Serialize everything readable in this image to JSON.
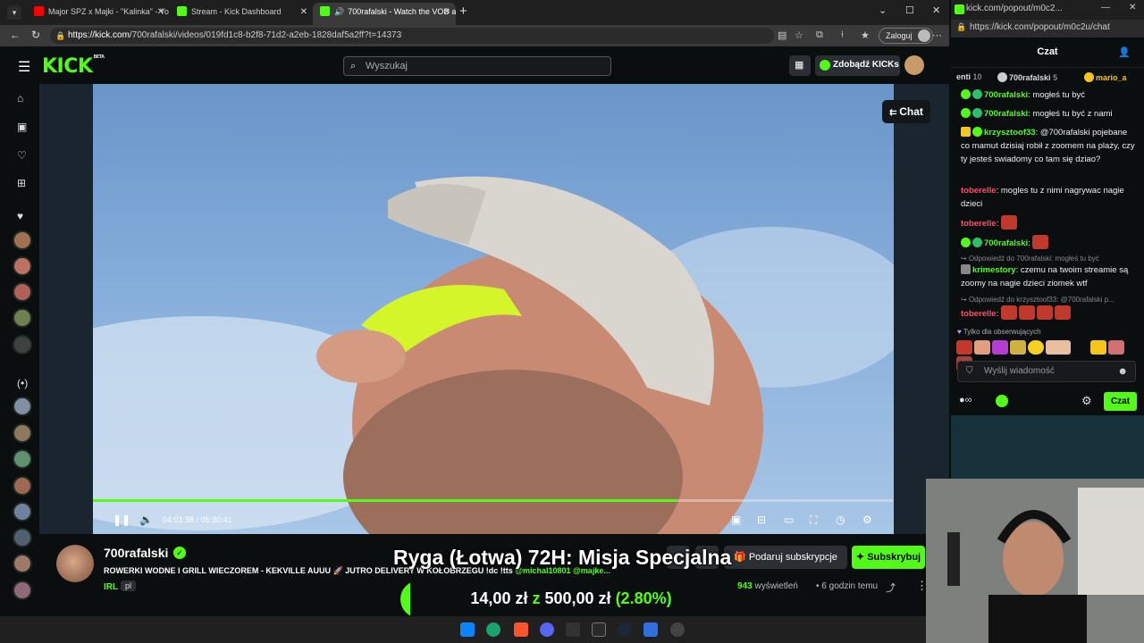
{
  "browser": {
    "tabs": [
      {
        "title": "Major SPZ x Majki - \"Kalinka\" - Yo",
        "favicon_color": "#ff0000"
      },
      {
        "title": "Stream - Kick Dashboard",
        "favicon_color": "#53fc18"
      },
      {
        "title": "700rafalski - Watch the VOD a",
        "favicon_color": "#53fc18",
        "active": true
      }
    ],
    "url_host": "https://kick.com",
    "url_path": "/700rafalski/videos/019fd1c8-b2f8-71d2-a2eb-1828daf5a2ff?t=14373",
    "login_label": "Zaloguj"
  },
  "kick": {
    "logo": "KICK",
    "logo_tag": "BETA",
    "search_placeholder": "Wyszukaj",
    "get_kicks_label": "Zdobądź KICKs",
    "chat_toggle_label": "Chat"
  },
  "player": {
    "time_current": "04:01:38",
    "time_separator": "/",
    "time_total": "05:30:41",
    "progress": 0.73
  },
  "video_info": {
    "streamer": "700rafalski",
    "title": "ROWERKI WODNE I GRILL WIECZOREM - KEKVILLE AUUU 🚀 JUTRO DELIVERY W KOŁOBRZEGU !dc !tts ",
    "mentions": "@michal10801 @majke...",
    "category": "IRL",
    "language": "pl",
    "gift_label": "Podaruj subskrypcje",
    "subscribe_label": "Subskrybuj",
    "views_count": "943",
    "views_label": "wyświetleń",
    "dot": "•",
    "time_ago": "6 godzin temu"
  },
  "overlay": {
    "title": "Ryga (Łotwa) 72H: Misja Specjalna",
    "goal_current": "14,00 zł",
    "goal_sep": "z",
    "goal_target": "500,00 zł",
    "goal_percent": "(2.80%)",
    "goal_fraction": 0.028
  },
  "popout": {
    "window_title": "kick.com/popout/m0c2...",
    "url": "https://kick.com/popout/m0c2u/chat",
    "chat_title": "Czat",
    "top_users": [
      {
        "name": "enti",
        "count": "10"
      },
      {
        "name": "700rafalski",
        "count": "5"
      },
      {
        "name": "mario_a",
        "count": ""
      }
    ],
    "messages": [
      {
        "user": "700rafalski",
        "color": "green",
        "text": ": mogłeś tu być"
      },
      {
        "user": "700rafalski",
        "color": "green",
        "text": ": mogłeś tu być z nami"
      },
      {
        "user": "krzysztoof33",
        "color": "green",
        "text": ": @700rafalski pojebane co mamut dzisiaj robił z zoomem na plaży, czy ty jesteś swiadomy co tam się dziao?"
      },
      {
        "user": "toberelle",
        "color": "red",
        "text": ": mogles tu z nimi nagrywac nagie dzieci"
      },
      {
        "user": "toberelle",
        "color": "red",
        "text": ":"
      },
      {
        "user": "700rafalski",
        "color": "green",
        "text": ":"
      },
      {
        "reply": "Odpowiedź do 700rafalski: mogłeś tu być"
      },
      {
        "user": "krimestory",
        "color": "green",
        "text": ": czemu na twoim streamie są zoomy na nagie dzieci ziomek wtf"
      },
      {
        "reply": "Odpowiedź do krzysztoof33: @700rafalski p..."
      },
      {
        "user": "toberelle",
        "color": "red",
        "text": ":"
      }
    ],
    "followers_only": "Tylko dla obserwujących",
    "input_placeholder": "Wyślij wiadomość",
    "send_label": "Czat"
  }
}
